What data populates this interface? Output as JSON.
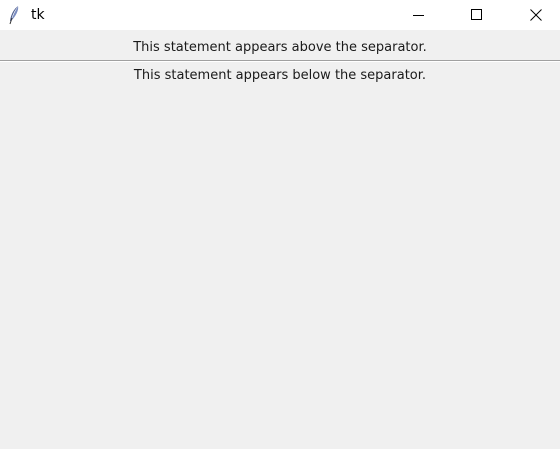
{
  "window": {
    "title": "tk",
    "app_icon": "feather-icon",
    "controls": [
      "minimize-icon",
      "maximize-icon",
      "close-icon"
    ]
  },
  "content": {
    "label_above": "This statement appears above the separator.",
    "label_below": "This statement appears below the separator."
  },
  "colors": {
    "background": "#f0f0f0",
    "titlebar": "#ffffff",
    "separator": "#a0a0a0"
  }
}
